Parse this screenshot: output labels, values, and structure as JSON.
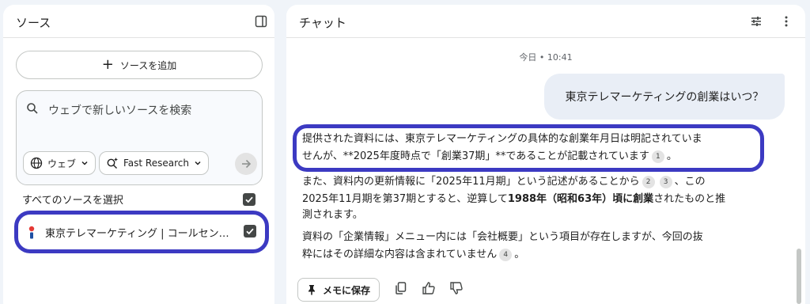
{
  "sources_panel": {
    "title": "ソース",
    "add_source_label": "ソースを追加",
    "search": {
      "placeholder": "ウェブで新しいソースを検索",
      "source_chip": "ウェブ",
      "mode_chip": "Fast Research"
    },
    "select_all_label": "すべてのソースを選択",
    "items": [
      {
        "title": "東京テレマーケティング | コールセンター",
        "checked": true
      }
    ],
    "select_all_checked": true
  },
  "chat_panel": {
    "title": "チャット",
    "timestamp": "今日 • 10:41",
    "user_message": "東京テレマーケティングの創業はいつ？",
    "answer": {
      "line1": "提供された資料には、東京テレマーケティングの具体的な創業年月日は明記されていま",
      "line2": "せんが、**2025年度時点で「創業37期」**であることが記載されています",
      "line2_cite": "1",
      "line2_end": "。",
      "line3_a": "また、資料内の更新情報に「2025年11月期」という記述があることから",
      "line3_cite_a": "2",
      "line3_cite_b": "3",
      "line3_b": "、この",
      "line4_a": "2025年11月期を第37期とすると、逆算して",
      "line4_bold": "1988年（昭和63年）頃に創業",
      "line4_b": "されたものと推",
      "line5": "測されます。",
      "line6": "資料の「企業情報」メニュー内には「会社概要」という項目が存在しますが、今回の抜",
      "line7_a": "粋にはその詳細な内容は含まれていません",
      "line7_cite": "4",
      "line7_b": "。"
    },
    "save_note_label": "メモに保存"
  },
  "colors": {
    "highlight": "#3c3ac2",
    "panel_bg": "#ffffff",
    "page_bg": "#f0f4f9",
    "user_bubble": "#e9eef6"
  },
  "icons": [
    "sidebar-toggle-icon",
    "tune-icon",
    "more-vert-icon",
    "plus-icon",
    "search-icon",
    "globe-icon",
    "chevron-down-icon",
    "sparkle-search-icon",
    "arrow-right-icon",
    "checkbox-icon",
    "favicon-icon",
    "pin-icon",
    "copy-icon",
    "thumb-up-icon",
    "thumb-down-icon"
  ]
}
